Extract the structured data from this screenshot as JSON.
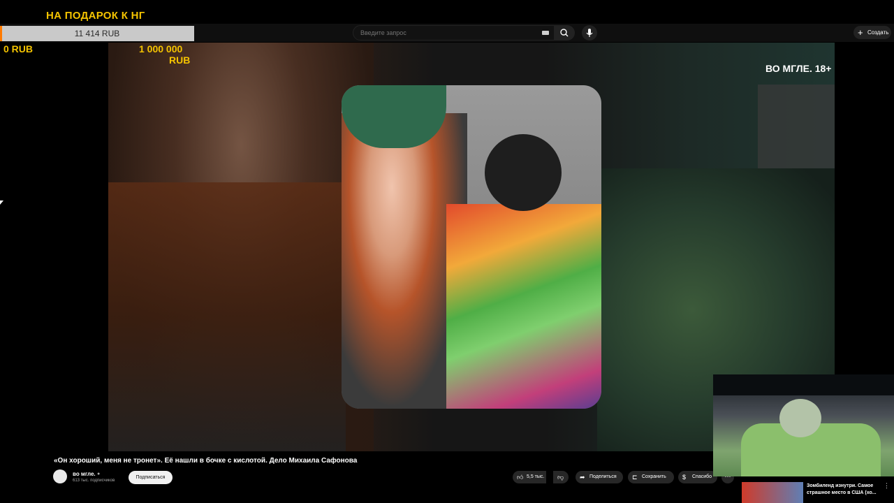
{
  "donation": {
    "title": "НА ПОДАРОК К НГ",
    "current": "11 414 RUB",
    "min": "0 RUB",
    "max_line1": "1 000 000",
    "max_line2": "RUB",
    "progress_fraction": 0.0114
  },
  "header": {
    "search_placeholder": "Введите запрос",
    "create_label": "Создать"
  },
  "video": {
    "watermark": "ВО МГЛЕ. 18+",
    "title": "«Он хороший, меня не тронет». Её нашли в бочке с кислотой. Дело Михаила Сафонова"
  },
  "channel": {
    "name": "во мгле.",
    "subscribers": "613 тыс. подписчиков",
    "subscribe_label": "Подписаться"
  },
  "actions": {
    "likes": "5,5 тыс.",
    "share_label": "Поделиться",
    "save_label": "Сохранить",
    "thanks_label": "Спасибо",
    "more": "···"
  },
  "suggested": {
    "title": "Зомбиленд изнутри. Самое страшное место в США (хо..."
  },
  "icons": {
    "search": "search-icon",
    "mic": "mic-icon",
    "plus": "plus-icon",
    "like": "thumbs-up-icon",
    "dislike": "thumbs-down-icon",
    "share": "share-icon",
    "save": "bookmark-icon",
    "thanks": "thanks-icon"
  },
  "colors": {
    "accent_yellow": "#f5c400",
    "progress_orange": "#ff7a00"
  }
}
